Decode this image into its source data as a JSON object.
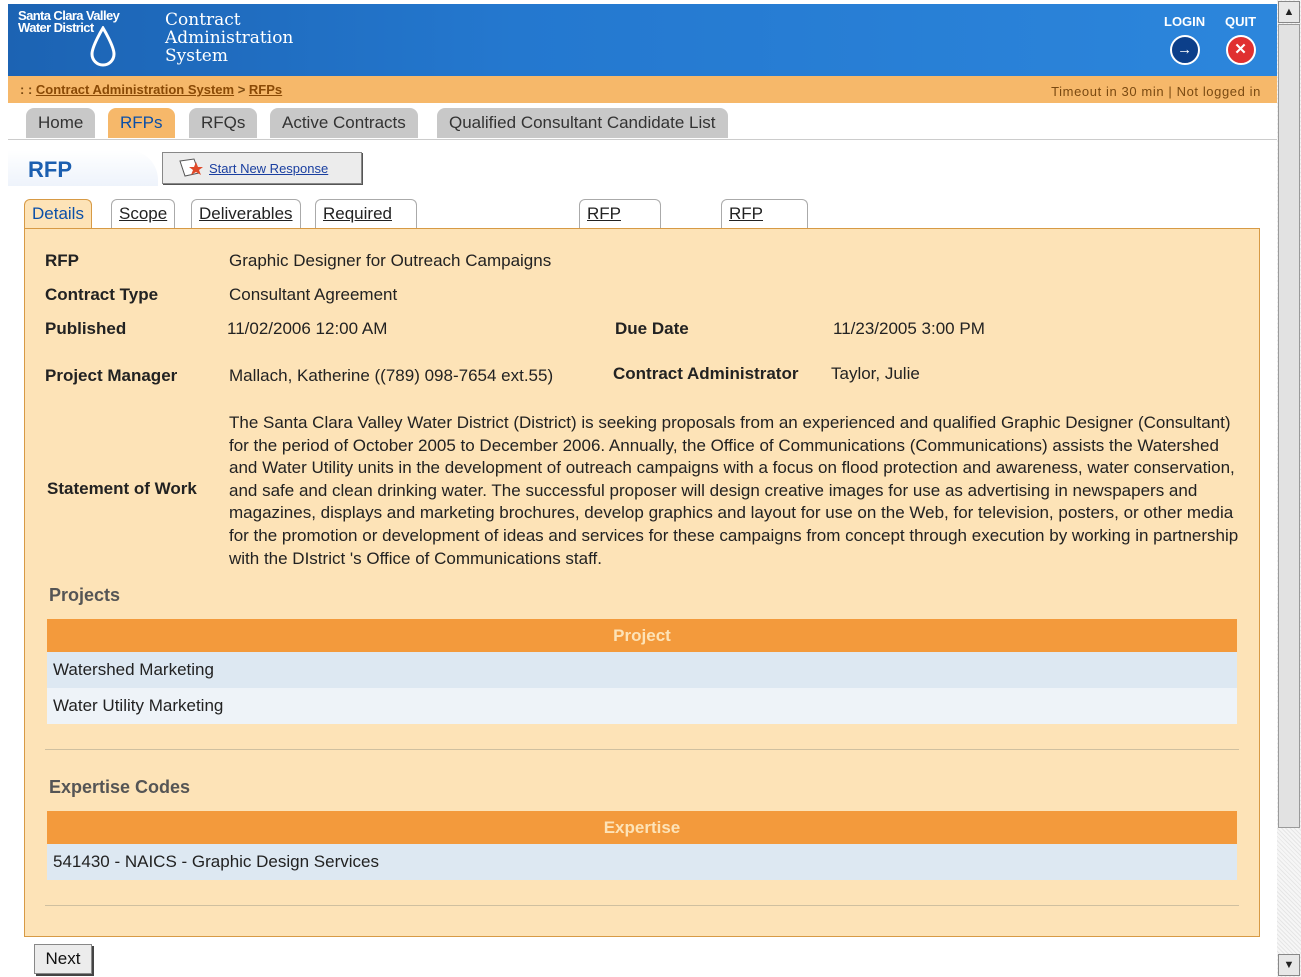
{
  "header": {
    "logo_line1": "Santa Clara Valley",
    "logo_line2": "Water District",
    "app_title_line1": "Contract",
    "app_title_line2": "Administration",
    "app_title_line3": "System",
    "login_label": "LOGIN",
    "quit_label": "QUIT",
    "login_icon": "login-icon",
    "quit_icon": "close-icon"
  },
  "breadcrumb": {
    "prefix": ": :",
    "root": "Contract Administration System",
    "separator": ">",
    "current": "RFPs"
  },
  "status": {
    "timeout": "Timeout in 30 min",
    "separator": "|",
    "login_state": "Not logged in"
  },
  "nav": {
    "tabs": [
      "Home",
      "RFPs",
      "RFQs",
      "Active Contracts",
      "Qualified Consultant Candidate List"
    ],
    "active": "RFPs"
  },
  "page": {
    "title": "RFP",
    "start_button": "Start New Response"
  },
  "subtabs": {
    "tabs": [
      "Details",
      "Scope",
      "Deliverables",
      "Required Documents for NTP",
      "RFP Package",
      "RFP Schedule"
    ],
    "active": "Details"
  },
  "details": {
    "rfp_label": "RFP",
    "rfp_value": "Graphic Designer for Outreach Campaigns",
    "contract_type_label": "Contract Type",
    "contract_type_value": "Consultant Agreement",
    "published_label": "Published",
    "published_value": "11/02/2006 12:00 AM",
    "due_date_label": "Due Date",
    "due_date_value": "11/23/2005 3:00 PM",
    "pm_label": "Project Manager",
    "pm_value": "Mallach, Katherine ((789) 098-7654 ext.55)",
    "ca_label": "Contract Administrator",
    "ca_value": "Taylor, Julie",
    "sow_label": "Statement of Work",
    "sow_value": "The Santa Clara Valley Water District (District) is seeking proposals from an experienced and qualified Graphic Designer (Consultant)  for the period of October 2005 to December 2006. Annually, the Office of Communications (Communications) assists the Watershed and Water Utility units in the development of outreach campaigns with a focus on flood protection and awareness, water conservation, and safe and clean drinking water. The successful proposer will design creative images for use as advertising in newspapers and magazines, displays and marketing brochures, develop graphics and layout for use on the Web, for television, posters, or other media for the promotion or development of ideas and services for these campaigns from concept through execution by working in partnership with the DIstrict 's Office of Communications staff."
  },
  "projects": {
    "heading": "Projects",
    "column": "Project",
    "rows": [
      "Watershed Marketing",
      "Water Utility Marketing"
    ]
  },
  "expertise": {
    "heading": "Expertise Codes",
    "column": "Expertise",
    "rows": [
      "541430 - NAICS - Graphic Design Services"
    ]
  },
  "footer": {
    "next_label": "Next"
  },
  "colors": {
    "header_blue": "#2478cf",
    "accent_orange": "#f39a3c",
    "panel_bg": "#fde3b7"
  }
}
